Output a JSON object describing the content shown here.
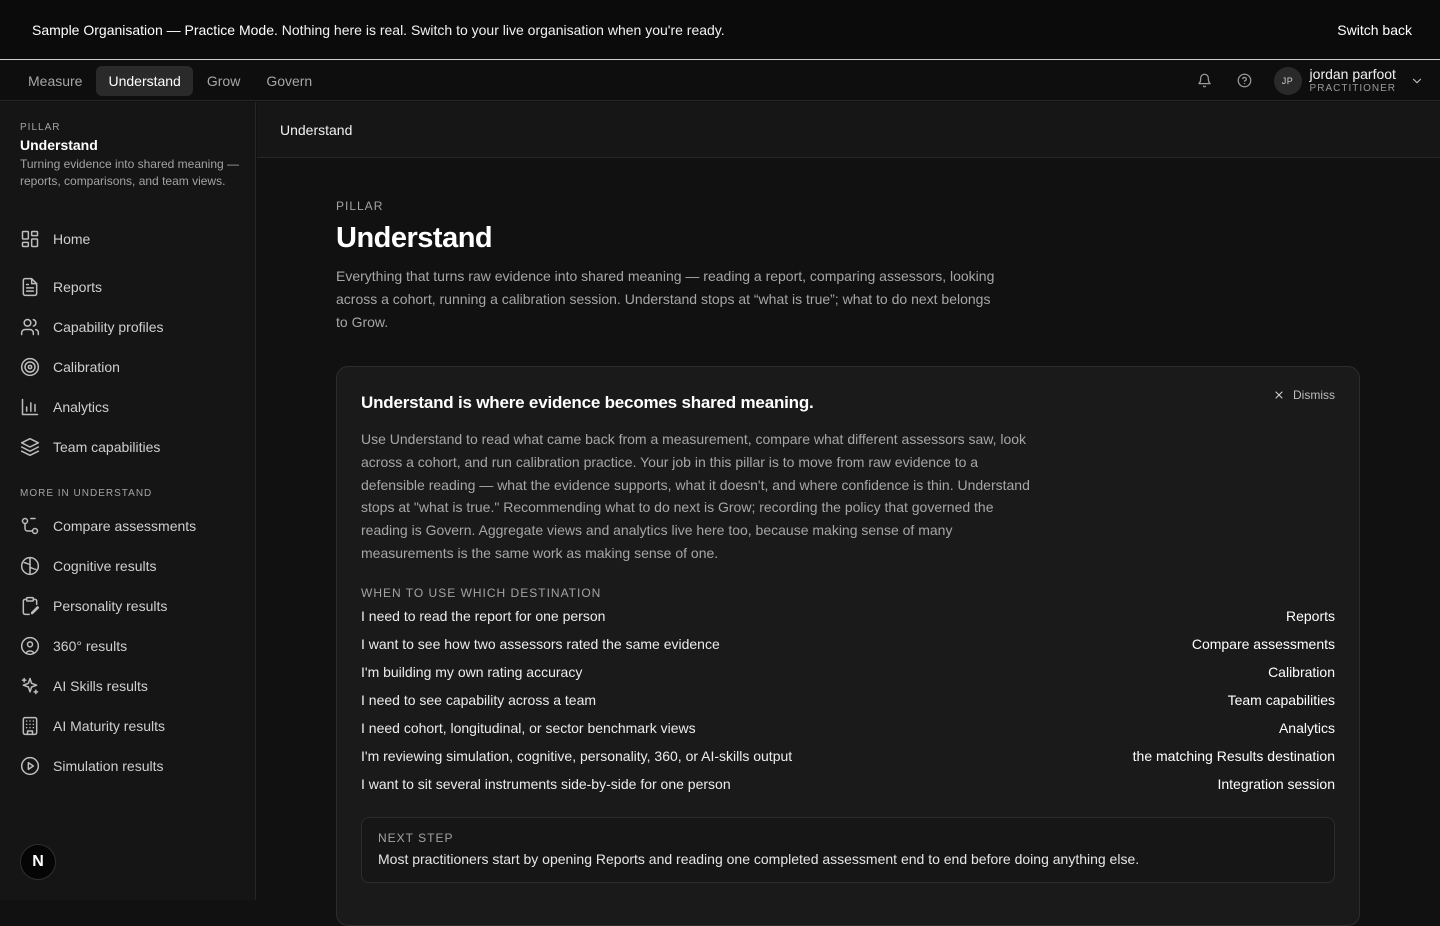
{
  "banner": {
    "strong": "Sample Organisation — Practice Mode.",
    "text": " Nothing here is real. Switch to your live organisation when you're ready.",
    "switch_label": "Switch back"
  },
  "topnav": {
    "tabs": [
      {
        "label": "Measure",
        "active": false
      },
      {
        "label": "Understand",
        "active": true
      },
      {
        "label": "Grow",
        "active": false
      },
      {
        "label": "Govern",
        "active": false
      }
    ],
    "icons": [
      "bell-icon",
      "help-circle-icon"
    ],
    "user": {
      "initials": "JP",
      "name": "jordan parfoot",
      "role": "PRACTITIONER"
    }
  },
  "sidebar": {
    "kicker": "PILLAR",
    "title": "Understand",
    "description": "Turning evidence into shared meaning — reports, comparisons, and team views.",
    "home": {
      "label": "Home",
      "icon": "grid-icon"
    },
    "items": [
      {
        "label": "Reports",
        "icon": "file-text-icon"
      },
      {
        "label": "Capability profiles",
        "icon": "users-icon"
      },
      {
        "label": "Calibration",
        "icon": "target-icon"
      },
      {
        "label": "Analytics",
        "icon": "bar-chart-icon"
      },
      {
        "label": "Team capabilities",
        "icon": "layers-icon"
      }
    ],
    "more_heading": "MORE IN UNDERSTAND",
    "more_items": [
      {
        "label": "Compare assessments",
        "icon": "git-compare-icon"
      },
      {
        "label": "Cognitive results",
        "icon": "brain-icon"
      },
      {
        "label": "Personality results",
        "icon": "clipboard-edit-icon"
      },
      {
        "label": "360° results",
        "icon": "user-circle-icon"
      },
      {
        "label": "AI Skills results",
        "icon": "sparkles-icon"
      },
      {
        "label": "AI Maturity results",
        "icon": "building-icon"
      },
      {
        "label": "Simulation results",
        "icon": "play-circle-icon"
      }
    ],
    "logo_letter": "N"
  },
  "breadcrumb": "Understand",
  "main": {
    "kicker": "PILLAR",
    "title": "Understand",
    "lede": "Everything that turns raw evidence into shared meaning — reading a report, comparing assessors, looking across a cohort, running a calibration session. Understand stops at “what is true”; what to do next belongs to Grow.",
    "card": {
      "title": "Understand is where evidence becomes shared meaning.",
      "dismiss_label": "Dismiss",
      "body": "Use Understand to read what came back from a measurement, compare what different assessors saw, look across a cohort, and run calibration practice. Your job in this pillar is to move from raw evidence to a defensible reading — what the evidence supports, what it doesn't, and where confidence is thin. Understand stops at \"what is true.\" Recommending what to do next is Grow; recording the policy that governed the reading is Govern. Aggregate views and analytics live here too, because making sense of many measurements is the same work as making sense of one.",
      "dest_heading": "WHEN TO USE WHICH DESTINATION",
      "destinations": [
        {
          "need": "I need to read the report for one person",
          "dest": "Reports"
        },
        {
          "need": "I want to see how two assessors rated the same evidence",
          "dest": "Compare assessments"
        },
        {
          "need": "I'm building my own rating accuracy",
          "dest": "Calibration"
        },
        {
          "need": "I need to see capability across a team",
          "dest": "Team capabilities"
        },
        {
          "need": "I need cohort, longitudinal, or sector benchmark views",
          "dest": "Analytics"
        },
        {
          "need": "I'm reviewing simulation, cognitive, personality, 360, or AI-skills output",
          "dest": "the matching Results destination"
        },
        {
          "need": "I want to sit several instruments side-by-side for one person",
          "dest": "Integration session"
        }
      ],
      "next_heading": "NEXT STEP",
      "next_text": "Most practitioners start by opening Reports and reading one completed assessment end to end before doing anything else."
    }
  }
}
